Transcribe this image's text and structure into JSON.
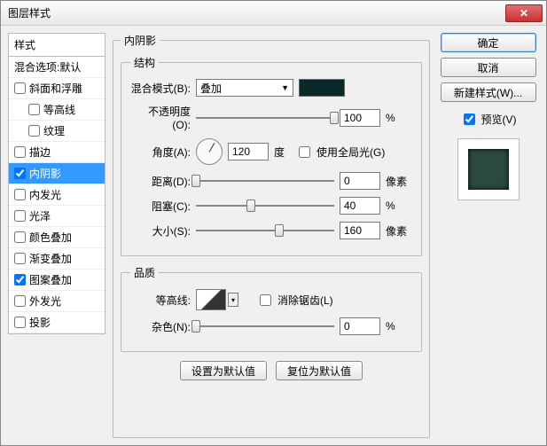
{
  "window": {
    "title": "图层样式"
  },
  "buttons": {
    "ok": "确定",
    "cancel": "取消",
    "newStyle": "新建样式(W)...",
    "close": "✕"
  },
  "preview": {
    "label": "预览(V)",
    "checked": true
  },
  "leftPanel": {
    "header": "样式",
    "items": [
      {
        "label": "混合选项:默认",
        "hasCheckbox": false
      },
      {
        "label": "斜面和浮雕",
        "hasCheckbox": true,
        "checked": false
      },
      {
        "label": "等高线",
        "hasCheckbox": true,
        "checked": false,
        "sub": true
      },
      {
        "label": "纹理",
        "hasCheckbox": true,
        "checked": false,
        "sub": true
      },
      {
        "label": "描边",
        "hasCheckbox": true,
        "checked": false
      },
      {
        "label": "内阴影",
        "hasCheckbox": true,
        "checked": true,
        "selected": true
      },
      {
        "label": "内发光",
        "hasCheckbox": true,
        "checked": false
      },
      {
        "label": "光泽",
        "hasCheckbox": true,
        "checked": false
      },
      {
        "label": "颜色叠加",
        "hasCheckbox": true,
        "checked": false
      },
      {
        "label": "渐变叠加",
        "hasCheckbox": true,
        "checked": false
      },
      {
        "label": "图案叠加",
        "hasCheckbox": true,
        "checked": true
      },
      {
        "label": "外发光",
        "hasCheckbox": true,
        "checked": false
      },
      {
        "label": "投影",
        "hasCheckbox": true,
        "checked": false
      }
    ]
  },
  "panel": {
    "title": "内阴影",
    "structure": {
      "legend": "结构",
      "blendMode": {
        "label": "混合模式(B):",
        "value": "叠加",
        "color": "#0a2a2a"
      },
      "opacity": {
        "label": "不透明度(O):",
        "value": "100",
        "unit": "%",
        "pos": 100
      },
      "angle": {
        "label": "角度(A):",
        "value": "120",
        "unit": "度",
        "globalLabel": "使用全局光(G)",
        "globalChecked": false
      },
      "distance": {
        "label": "距离(D):",
        "value": "0",
        "unit": "像素",
        "pos": 0
      },
      "choke": {
        "label": "阻塞(C):",
        "value": "40",
        "unit": "%",
        "pos": 40
      },
      "size": {
        "label": "大小(S):",
        "value": "160",
        "unit": "像素",
        "pos": 60
      }
    },
    "quality": {
      "legend": "品质",
      "contour": {
        "label": "等高线:",
        "antiAliasLabel": "消除锯齿(L)",
        "antiAliasChecked": false
      },
      "noise": {
        "label": "杂色(N):",
        "value": "0",
        "unit": "%",
        "pos": 0
      }
    },
    "footer": {
      "setDefault": "设置为默认值",
      "resetDefault": "复位为默认值"
    }
  }
}
